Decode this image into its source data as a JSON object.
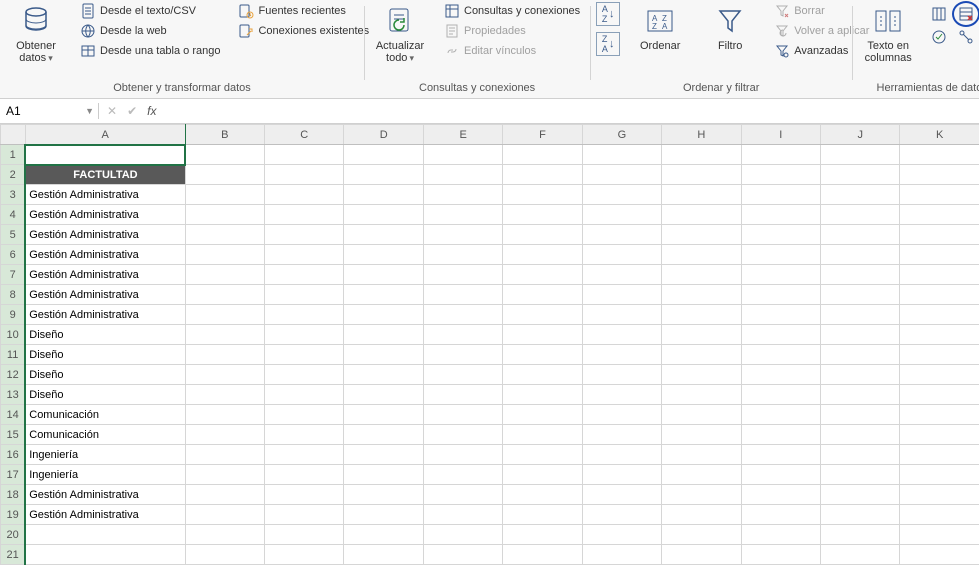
{
  "ribbon": {
    "groups": {
      "obtener": {
        "label": "Obtener y transformar datos",
        "obtener_datos": "Obtener\ndatos",
        "desde_csv": "Desde el texto/CSV",
        "desde_web": "Desde la web",
        "desde_tabla": "Desde una tabla o rango",
        "fuentes_recientes": "Fuentes recientes",
        "conexiones_existentes": "Conexiones existentes"
      },
      "consultas": {
        "label": "Consultas y conexiones",
        "actualizar": "Actualizar\ntodo",
        "consultas_conexiones": "Consultas y conexiones",
        "propiedades": "Propiedades",
        "editar_vinculos": "Editar vínculos"
      },
      "ordenar": {
        "label": "Ordenar y filtrar",
        "ordenar": "Ordenar",
        "filtro": "Filtro",
        "borrar": "Borrar",
        "volver_aplicar": "Volver a aplicar",
        "avanzadas": "Avanzadas"
      },
      "datos": {
        "label": "Herramientas de datos",
        "texto_columnas": "Texto en\ncolumnas"
      }
    }
  },
  "name_box": "A1",
  "columns": [
    "A",
    "B",
    "C",
    "D",
    "E",
    "F",
    "G",
    "H",
    "I",
    "J",
    "K"
  ],
  "rows": {
    "count": 21
  },
  "cells": {
    "A": [
      "",
      "FACTULTAD",
      "Gestión Administrativa",
      "Gestión Administrativa",
      "Gestión Administrativa",
      "Gestión Administrativa",
      "Gestión Administrativa",
      "Gestión Administrativa",
      "Gestión Administrativa",
      "Diseño",
      "Diseño",
      "Diseño",
      "Diseño",
      "Comunicación",
      "Comunicación",
      "Ingeniería",
      "Ingeniería",
      "Gestión Administrativa",
      "Gestión Administrativa",
      "",
      ""
    ]
  }
}
